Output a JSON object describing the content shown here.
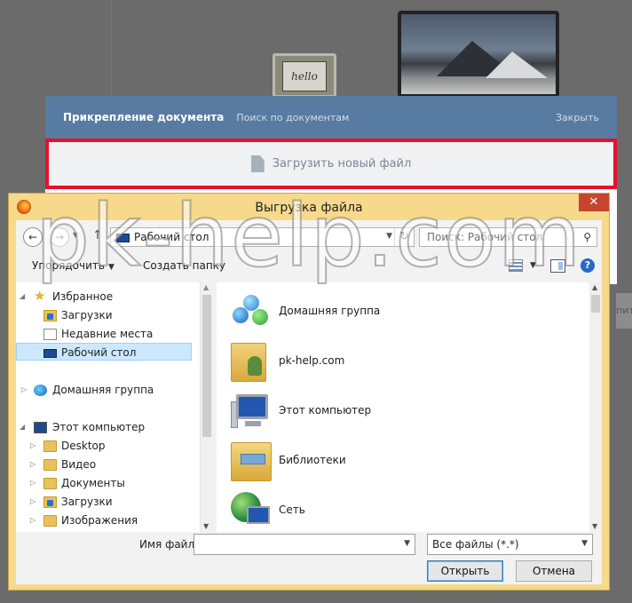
{
  "background": {
    "hello_label": "hello",
    "right_fragment": "пити",
    "bottom_fragment": "..."
  },
  "vk_dialog": {
    "title": "Прикрепление документа",
    "tab_search": "Поиск по документам",
    "close_label": "Закрыть",
    "upload_label": "Загрузить новый файл",
    "highlight_color": "#e8102a",
    "header_color": "#587ba1"
  },
  "file_dialog": {
    "title": "Выгрузка файла",
    "close_glyph": "✕",
    "address": {
      "location": "Рабочий стол",
      "refresh_glyph": "↻"
    },
    "search_placeholder": "Поиск: Рабочий стол",
    "toolbar": {
      "organize": "Упорядочить",
      "new_folder": "Создать папку",
      "help_glyph": "?"
    },
    "nav_tree": [
      {
        "label": "Избранное",
        "icon": "star-icon"
      },
      {
        "label": "Загрузки",
        "icon": "downloads-folder-icon"
      },
      {
        "label": "Недавние места",
        "icon": "recent-places-icon"
      },
      {
        "label": "Рабочий стол",
        "icon": "desktop-icon",
        "selected": true
      },
      {
        "label": "Домашняя группа",
        "icon": "homegroup-icon"
      },
      {
        "label": "Этот компьютер",
        "icon": "computer-icon"
      },
      {
        "label": "Desktop",
        "icon": "folder-icon"
      },
      {
        "label": "Видео",
        "icon": "video-folder-icon"
      },
      {
        "label": "Документы",
        "icon": "documents-folder-icon"
      },
      {
        "label": "Загрузки",
        "icon": "downloads-folder-icon"
      },
      {
        "label": "Изображения",
        "icon": "pictures-folder-icon"
      }
    ],
    "files": [
      {
        "name": "Домашняя группа",
        "icon": "homegroup-icon"
      },
      {
        "name": "pk-help.com",
        "icon": "user-folder-icon"
      },
      {
        "name": "Этот компьютер",
        "icon": "computer-icon"
      },
      {
        "name": "Библиотеки",
        "icon": "libraries-icon"
      },
      {
        "name": "Сеть",
        "icon": "network-icon"
      }
    ],
    "filename_label": "Имя файла:",
    "filename_value": "",
    "filter_value": "Все файлы (*.*)",
    "open_button": "Открыть",
    "cancel_button": "Отмена",
    "frame_color": "#f6d98a"
  },
  "watermark": "pk-help.com"
}
